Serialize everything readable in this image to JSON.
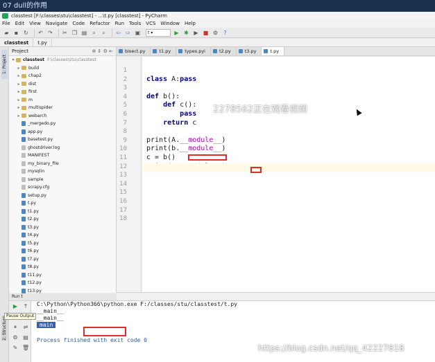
{
  "top_overlay": "07 dull的作用",
  "window_title": "classtest [F:\\classes\\stu\\classtest] - ...\\t.py [classtest] - PyCharm",
  "menu": [
    "File",
    "Edit",
    "View",
    "Navigate",
    "Code",
    "Refactor",
    "Run",
    "Tools",
    "VCS",
    "Window",
    "Help"
  ],
  "toolbar": {
    "run_config": "t"
  },
  "breadcrumbs": [
    "classtest",
    "t.py"
  ],
  "project_panel": {
    "tab_label": "1: Project",
    "header": "Project",
    "root": "classtest",
    "root_path": "F:\\classes\\stu\\classtest",
    "items": [
      {
        "label": "build",
        "kind": "folder"
      },
      {
        "label": "chap2",
        "kind": "folder"
      },
      {
        "label": "dist",
        "kind": "folder"
      },
      {
        "label": "first",
        "kind": "folder"
      },
      {
        "label": "m",
        "kind": "folder"
      },
      {
        "label": "multispider",
        "kind": "folder"
      },
      {
        "label": "webarch",
        "kind": "folder"
      },
      {
        "label": "_mergedo.py",
        "kind": "py"
      },
      {
        "label": "app.py",
        "kind": "py"
      },
      {
        "label": "basetest.py",
        "kind": "py"
      },
      {
        "label": "ghostdriver.log",
        "kind": "txt"
      },
      {
        "label": "MANIFEST",
        "kind": "txt"
      },
      {
        "label": "my_binary_file",
        "kind": "txt"
      },
      {
        "label": "mysqlin",
        "kind": "txt"
      },
      {
        "label": "sample",
        "kind": "txt"
      },
      {
        "label": "scrapy.cfg",
        "kind": "txt"
      },
      {
        "label": "setup.py",
        "kind": "py"
      },
      {
        "label": "t.py",
        "kind": "py"
      },
      {
        "label": "t1.py",
        "kind": "py"
      },
      {
        "label": "t2.py",
        "kind": "py"
      },
      {
        "label": "t3.py",
        "kind": "py"
      },
      {
        "label": "t4.py",
        "kind": "py"
      },
      {
        "label": "t5.py",
        "kind": "py"
      },
      {
        "label": "t6.py",
        "kind": "py"
      },
      {
        "label": "t7.py",
        "kind": "py"
      },
      {
        "label": "t8.py",
        "kind": "py"
      },
      {
        "label": "t11.py",
        "kind": "py"
      },
      {
        "label": "t12.py",
        "kind": "py"
      },
      {
        "label": "t13.py",
        "kind": "py"
      }
    ]
  },
  "editor_tabs": [
    "bisect.py",
    "t1.py",
    "types.pyi",
    "t2.py",
    "t3.py",
    "t.py"
  ],
  "code_lines": [
    {
      "n": "1",
      "text": ""
    },
    {
      "n": "2",
      "text": "class A:pass"
    },
    {
      "n": "3",
      "text": ""
    },
    {
      "n": "4",
      "text": "def b():"
    },
    {
      "n": "5",
      "text": "    def c():"
    },
    {
      "n": "6",
      "text": "        pass"
    },
    {
      "n": "7",
      "text": "    return c"
    },
    {
      "n": "8",
      "text": ""
    },
    {
      "n": "9",
      "text": "print(A.__module__)"
    },
    {
      "n": "10",
      "text": "print(b.__module__)"
    },
    {
      "n": "11",
      "text": "c = b()"
    },
    {
      "n": "12",
      "text": "print(c.__module__)"
    },
    {
      "n": "13",
      "text": ""
    },
    {
      "n": "14",
      "text": ""
    },
    {
      "n": "15",
      "text": ""
    },
    {
      "n": "16",
      "text": ""
    },
    {
      "n": "17",
      "text": ""
    },
    {
      "n": "18",
      "text": ""
    }
  ],
  "live_watermark": "2278562正在观看视频",
  "run_panel": {
    "header": "Run  t",
    "tooltip": "Pause Output",
    "structure_tab": "2: Structure",
    "output": [
      "C:\\Python\\Python366\\python.exe F:/classes/stu/classtest/t.py",
      "__main__",
      "__main__",
      "main",
      "",
      "Process finished with exit code 0"
    ]
  },
  "bottom_watermark": "https://blog.csdn.net/qq_42227818"
}
